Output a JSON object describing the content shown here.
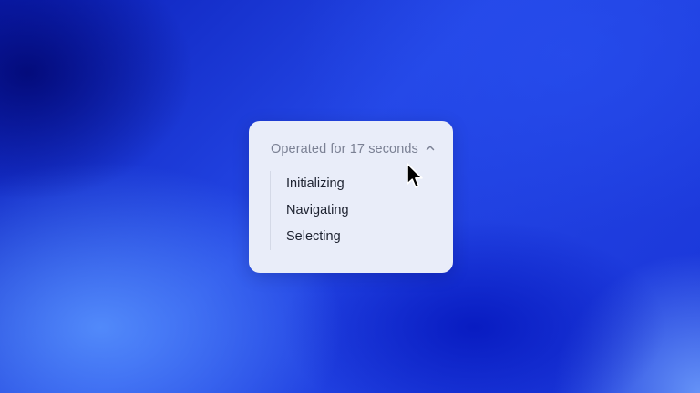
{
  "panel": {
    "header_label": "Operated for 17 seconds",
    "toggle_icon": "chevron-up-icon",
    "expanded": true,
    "steps": [
      {
        "label": "Initializing"
      },
      {
        "label": "Navigating"
      },
      {
        "label": "Selecting"
      }
    ]
  },
  "cursor": {
    "icon": "mouse-pointer-icon"
  },
  "colors": {
    "background_accent": "#1f3fe0",
    "card_background": "#e9edf9",
    "header_text": "#7b8194",
    "step_text": "#1d2230",
    "step_rail": "#d4d9e7"
  }
}
